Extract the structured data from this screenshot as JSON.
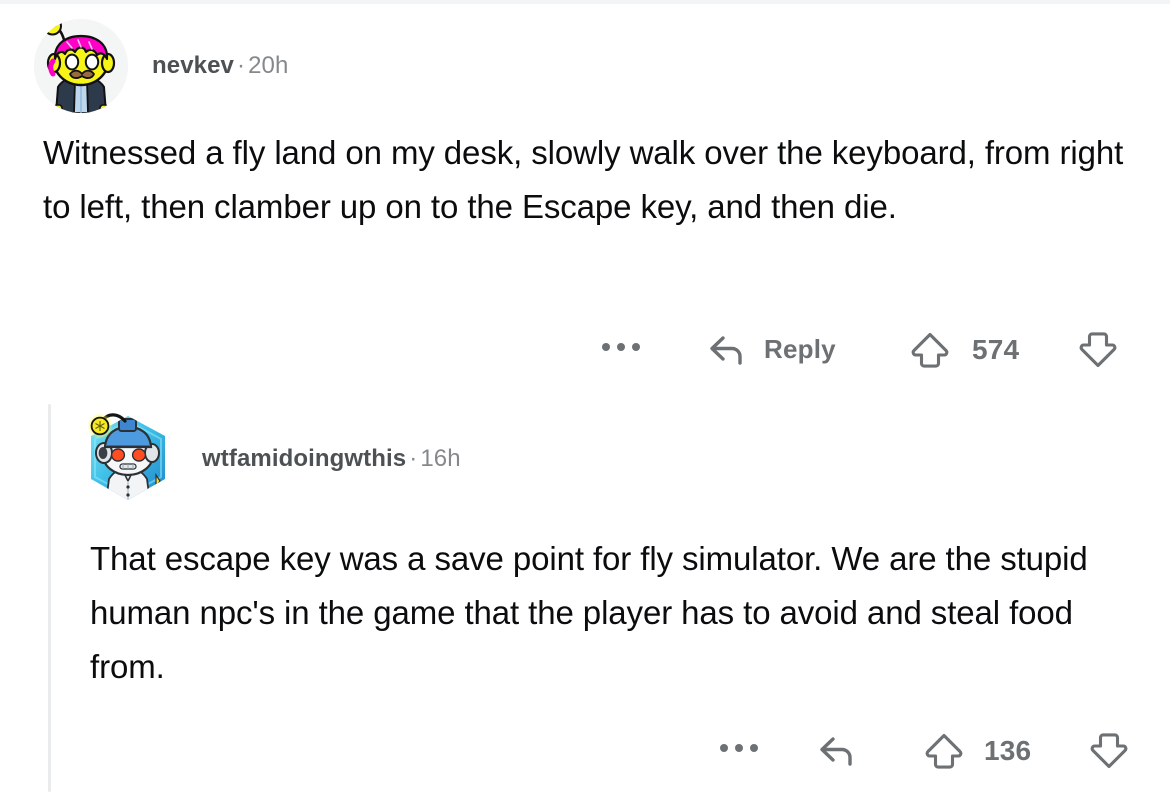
{
  "thread": {
    "comments": [
      {
        "id": "comment-1",
        "author": "nevkev",
        "separator": "·",
        "timestamp": "20h",
        "avatar_icon": "snoo-avatar-pink-hair",
        "body": "Witnessed a fly land on my desk, slowly walk over the keyboard, from right to left, then clamber up on to the Escape key, and then die.",
        "actions": {
          "more_icon": "ellipsis-icon",
          "reply_icon": "reply-arrow-icon",
          "reply_label": "Reply",
          "upvote_icon": "upvote-arrow-icon",
          "score": "574",
          "downvote_icon": "downvote-arrow-icon"
        }
      },
      {
        "id": "comment-2",
        "author": "wtfamidoingwthis",
        "separator": "·",
        "timestamp": "16h",
        "avatar_icon": "snoo-avatar-robot-hexagon",
        "body": "That escape key was a save point for fly simulator. We are the stupid human npc's in the game that the player has to avoid and steal food from.",
        "actions": {
          "more_icon": "ellipsis-icon",
          "reply_icon": "reply-arrow-icon",
          "reply_label": "",
          "upvote_icon": "upvote-arrow-icon",
          "score": "136",
          "downvote_icon": "downvote-arrow-icon"
        }
      }
    ]
  },
  "colors": {
    "page_background": "#ffffff",
    "body_text": "#0b0c0d",
    "meta_author": "#4d5154",
    "meta_time": "#85898c",
    "action_gray": "#6d7174",
    "thread_line": "#e9ebec",
    "avatar_1_skin": "#f7f517",
    "avatar_1_hair": "#ff00c8",
    "avatar_1_jacket": "#2c3a4b",
    "avatar_2_hex": "#35c5e8",
    "avatar_2_eyes": "#ff4d21",
    "avatar_2_helmet": "#3a86d6"
  }
}
